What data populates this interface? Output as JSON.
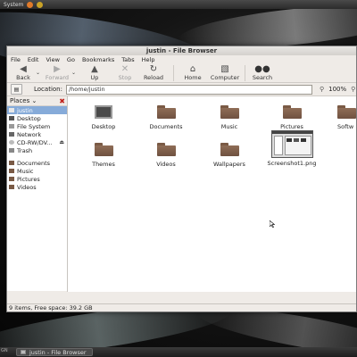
{
  "top_panel": {
    "menu_label": "System"
  },
  "window": {
    "title": "justin - File Browser",
    "menu": [
      "File",
      "Edit",
      "View",
      "Go",
      "Bookmarks",
      "Tabs",
      "Help"
    ],
    "toolbar": {
      "back": "Back",
      "forward": "Forward",
      "up": "Up",
      "stop": "Stop",
      "reload": "Reload",
      "home": "Home",
      "computer": "Computer",
      "search": "Search"
    },
    "location": {
      "label": "Location:",
      "value": "/home/justin",
      "zoom": "100%"
    },
    "sidebar": {
      "header": "Places",
      "items": [
        {
          "label": "justin",
          "icon": "home-icon"
        },
        {
          "label": "Desktop",
          "icon": "desktop-icon"
        },
        {
          "label": "File System",
          "icon": "filesystem-icon"
        },
        {
          "label": "Network",
          "icon": "network-icon"
        },
        {
          "label": "CD-RW/DV...",
          "icon": "cdrom-icon"
        },
        {
          "label": "Trash",
          "icon": "trash-icon"
        },
        {
          "label": "Documents",
          "icon": "folder-icon"
        },
        {
          "label": "Music",
          "icon": "folder-icon"
        },
        {
          "label": "Pictures",
          "icon": "folder-icon"
        },
        {
          "label": "Videos",
          "icon": "folder-icon"
        }
      ]
    },
    "files": [
      {
        "name": "Desktop",
        "type": "desktop"
      },
      {
        "name": "Documents",
        "type": "folder"
      },
      {
        "name": "Music",
        "type": "folder"
      },
      {
        "name": "Pictures",
        "type": "folder"
      },
      {
        "name": "Softw",
        "type": "folder"
      },
      {
        "name": "Themes",
        "type": "folder"
      },
      {
        "name": "Videos",
        "type": "folder"
      },
      {
        "name": "Wallpapers",
        "type": "folder"
      },
      {
        "name": "Screenshot1.png",
        "type": "image"
      }
    ],
    "status": "9 items, Free space: 39.2 GB"
  },
  "taskbar": {
    "left_stub": "GN",
    "task_label": "justin - File Browser"
  },
  "colors": {
    "selection": "#86abd9",
    "folder": "#7a5a45",
    "window_bg": "#efebe7"
  }
}
